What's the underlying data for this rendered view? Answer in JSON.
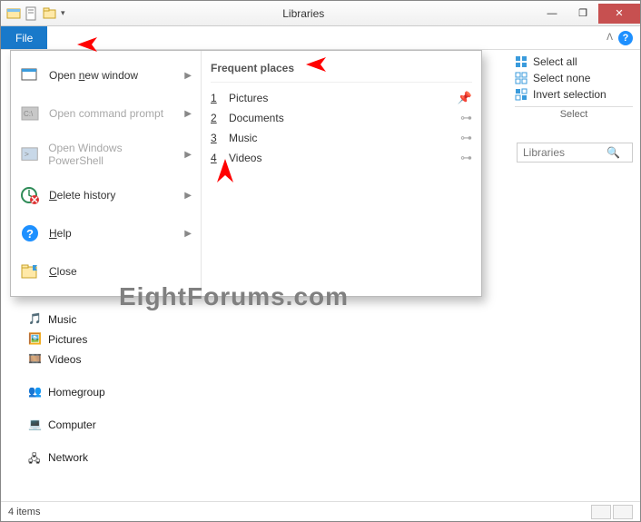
{
  "window": {
    "title": "Libraries",
    "minimize": "—",
    "maximize": "❐",
    "close": "✕"
  },
  "ribbon": {
    "file_tab": "File",
    "help_tooltip": "?"
  },
  "select_pane": {
    "select_all": "Select all",
    "select_none": "Select none",
    "invert": "Invert selection",
    "caption": "Select"
  },
  "search": {
    "placeholder": "Libraries"
  },
  "file_menu": {
    "open_new_window": "Open new window",
    "open_cmd": "Open command prompt",
    "open_ps": "Open Windows PowerShell",
    "delete_history": "Delete history",
    "help": "Help",
    "close": "Close",
    "frequent_header": "Frequent places",
    "freq": [
      {
        "n": "1",
        "label": "Pictures",
        "pinned": true
      },
      {
        "n": "2",
        "label": "Documents",
        "pinned": false
      },
      {
        "n": "3",
        "label": "Music",
        "pinned": false
      },
      {
        "n": "4",
        "label": "Videos",
        "pinned": false
      }
    ]
  },
  "navtree": {
    "music": "Music",
    "pictures": "Pictures",
    "videos": "Videos",
    "homegroup": "Homegroup",
    "computer": "Computer",
    "network": "Network"
  },
  "status": {
    "count": "4 items"
  },
  "watermark": "EightForums.com"
}
